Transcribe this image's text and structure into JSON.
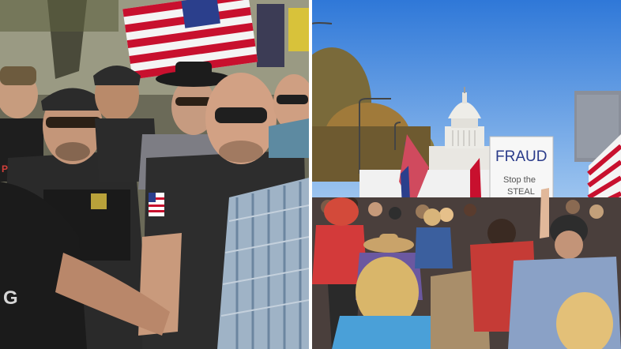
{
  "left_photo": {
    "flag_colors": {
      "red": "#c8102e",
      "white": "#f4f4f4",
      "blue": "#2b3f8c"
    },
    "shirt_text": "PEEKER",
    "shirt_letter": "G"
  },
  "right_photo": {
    "sign_line1": "FRAUD",
    "sign_line2": "Stop the",
    "sign_line3": "STEAL",
    "sky_color": "#3f86e0",
    "capitol_color": "#e9e7e2"
  }
}
